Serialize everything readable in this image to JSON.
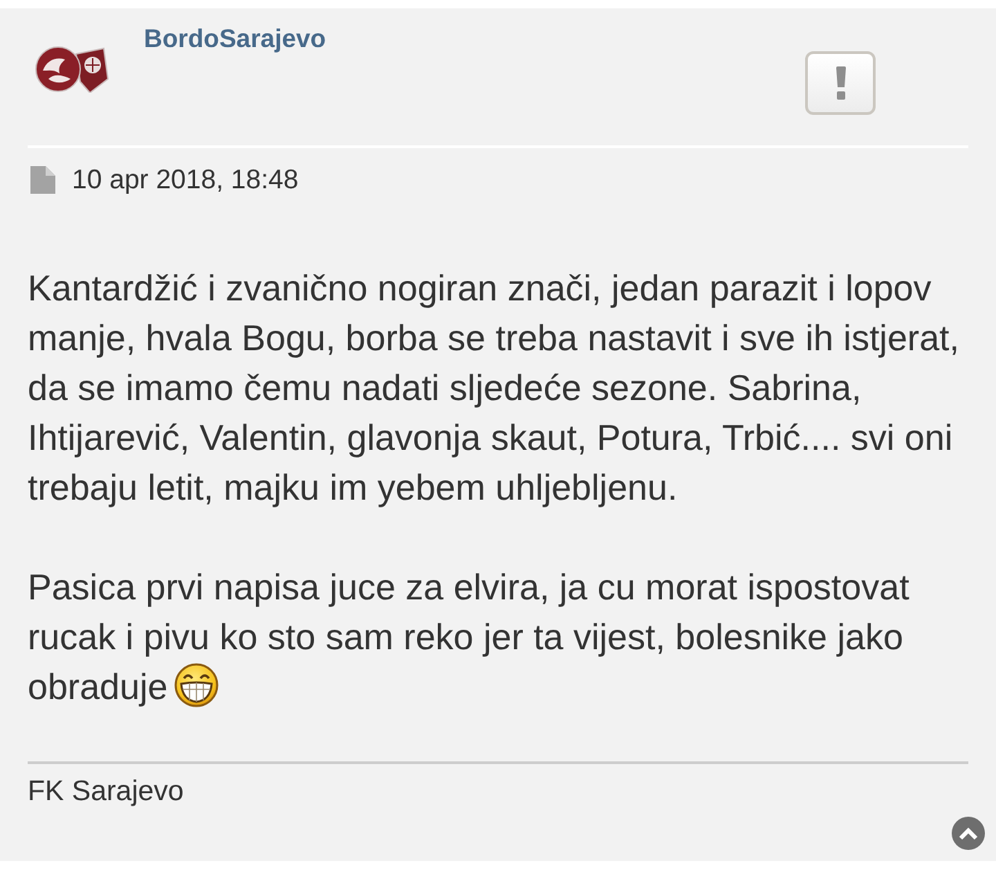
{
  "post": {
    "author": "BordoSarajevo",
    "date": "10 apr 2018, 18:48",
    "paragraphs": [
      {
        "lines": [
          "Kantardžić i zvanično nogiran znači, jedan parazit i lopov",
          "manje, hvala Bogu, borba se treba nastavit i sve ih istjerat,",
          "da se imamo čemu nadati sljedeće sezone. Sabrina,",
          "Ihtijarević, Valentin, glavonja skaut, Potura, Trbić.... svi oni",
          "trebaju letit, majku im yebem uhljebljenu."
        ]
      },
      {
        "lines": [
          "Pasica prvi napisa juce za elvira, ja cu morat ispostovat",
          "rucak i pivu ko sto sam reko jer ta vijest, bolesnike jako",
          "obraduje"
        ]
      }
    ],
    "signature": "FK Sarajevo"
  }
}
